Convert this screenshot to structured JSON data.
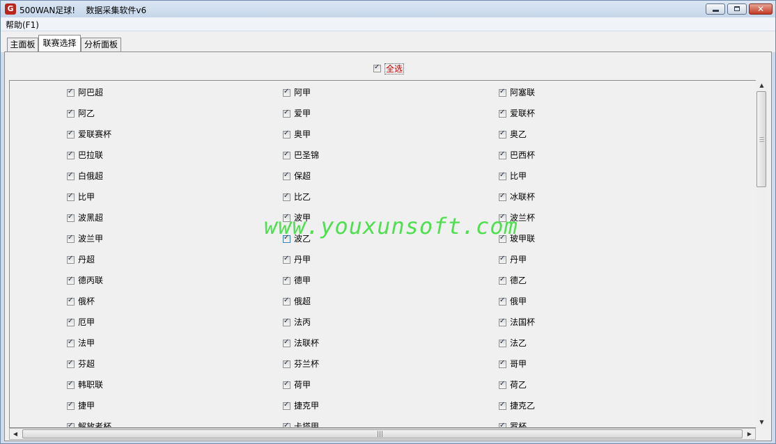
{
  "window": {
    "title": "500WAN足球!    数据采集软件v6",
    "app_icon_glyph": "G",
    "close_glyph": "✕"
  },
  "menu": {
    "help": "帮助(F1)"
  },
  "tabs": [
    {
      "label": "主面板",
      "active": false
    },
    {
      "label": "联赛选择",
      "active": true
    },
    {
      "label": "分析面板",
      "active": false
    }
  ],
  "select_all": {
    "label": "全选",
    "checked": true
  },
  "leagues": [
    [
      "阿巴超",
      "阿甲",
      "阿塞联"
    ],
    [
      "阿乙",
      "爱甲",
      "爱联杯"
    ],
    [
      "爱联赛杯",
      "奥甲",
      "奥乙"
    ],
    [
      "巴拉联",
      "巴圣锦",
      "巴西杯"
    ],
    [
      "白俄超",
      "保超",
      "比甲"
    ],
    [
      "比甲",
      "比乙",
      "冰联杯"
    ],
    [
      "波黑超",
      "波甲",
      "波兰杯"
    ],
    [
      "波兰甲",
      "波乙",
      "玻甲联"
    ],
    [
      "丹超",
      "丹甲",
      "丹甲"
    ],
    [
      "德丙联",
      "德甲",
      "德乙"
    ],
    [
      "俄杯",
      "俄超",
      "俄甲"
    ],
    [
      "厄甲",
      "法丙",
      "法国杯"
    ],
    [
      "法甲",
      "法联杯",
      "法乙"
    ],
    [
      "芬超",
      "芬兰杯",
      "哥甲"
    ],
    [
      "韩职联",
      "荷甲",
      "荷乙"
    ],
    [
      "捷甲",
      "捷克甲",
      "捷克乙"
    ],
    [
      "解放者杯",
      "卡塔甲",
      "罗杯"
    ]
  ],
  "scroll": {
    "vertical_position": 0.0,
    "horizontal_position": 0.0
  },
  "watermark": "www.youxunsoft.com",
  "colors": {
    "accent": "#4fe04f",
    "select_all_label": "#c00000",
    "close_button": "#c33a23"
  }
}
